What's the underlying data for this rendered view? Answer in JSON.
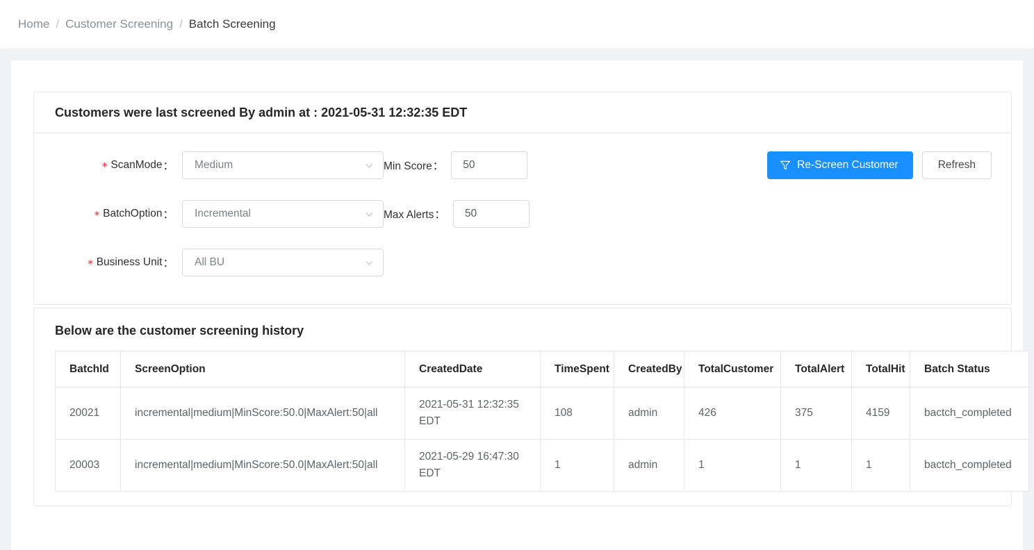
{
  "breadcrumb": {
    "items": [
      {
        "label": "Home",
        "current": false
      },
      {
        "label": "Customer Screening",
        "current": false
      },
      {
        "label": "Batch Screening",
        "current": true
      }
    ],
    "separator": "/"
  },
  "screening_card": {
    "title": "Customers were last screened By admin at : 2021-05-31 12:32:35 EDT",
    "form": {
      "scan_mode": {
        "label": "ScanMode",
        "value": "Medium",
        "required_marker": "*"
      },
      "batch_option": {
        "label": "BatchOption",
        "value": "Incremental",
        "required_marker": "*"
      },
      "business_unit": {
        "label": "Business Unit",
        "value": "All BU",
        "required_marker": "*"
      },
      "min_score": {
        "label": "Min Score",
        "value": "50"
      },
      "max_alerts": {
        "label": "Max Alerts",
        "value": "50"
      },
      "colon": "："
    },
    "actions": {
      "rescreen_label": "Re-Screen Customer",
      "rescreen_icon": "filter-funnel-icon",
      "refresh_label": "Refresh",
      "primary_color": "#1890ff"
    }
  },
  "history_card": {
    "title": "Below are the customer screening history",
    "table": {
      "columns": [
        "BatchId",
        "ScreenOption",
        "CreatedDate",
        "TimeSpent",
        "CreatedBy",
        "TotalCustomer",
        "TotalAlert",
        "TotalHit",
        "Batch Status"
      ],
      "rows": [
        {
          "batch_id": "20021",
          "screen_option": "incremental|medium|MinScore:50.0|MaxAlert:50|all",
          "created_date": "2021-05-31 12:32:35 EDT",
          "time_spent": "108",
          "created_by": "admin",
          "total_customer": "426",
          "total_alert": "375",
          "total_hit": "4159",
          "batch_status": "bactch_completed"
        },
        {
          "batch_id": "20003",
          "screen_option": "incremental|medium|MinScore:50.0|MaxAlert:50|all",
          "created_date": "2021-05-29 16:47:30 EDT",
          "time_spent": "1",
          "created_by": "admin",
          "total_customer": "1",
          "total_alert": "1",
          "total_hit": "1",
          "batch_status": "bactch_completed"
        }
      ]
    }
  }
}
